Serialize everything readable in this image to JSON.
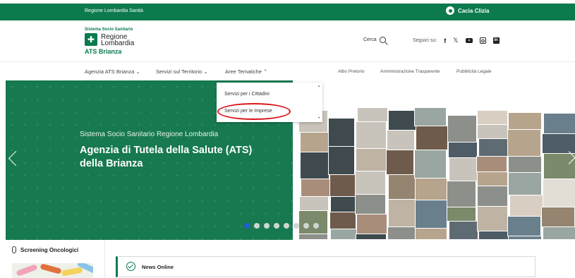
{
  "topbar": {
    "brand": "Regione Lombardia Sanità",
    "user": "Cacia Clizia"
  },
  "header": {
    "logo_top": "Sistema Socio Sanitario",
    "logo_region_line1": "Regione",
    "logo_region_line2": "Lombardia",
    "logo_ats": "ATS Brianza",
    "search_label": "Cerca",
    "social_label": "Seguici su:",
    "social_icons": [
      "facebook-icon",
      "x-icon",
      "youtube-icon",
      "instagram-icon",
      "linkedin-icon"
    ]
  },
  "nav": {
    "items": [
      "Agenzia ATS Brianza ⌄",
      "Servizi sul Territorio ⌄",
      "Aree Tematiche ⌃"
    ],
    "secondary": [
      "Albo Pretorio",
      "Amministrazione Trasparente",
      "Pubblicità Legale"
    ]
  },
  "dropdown": {
    "items": [
      "Servizi per i Cittadini",
      "Servizi per le Imprese"
    ],
    "highlighted": "Servizi per le Imprese"
  },
  "hero": {
    "kicker": "Sistema Socio Sanitario Regione Lombardia",
    "title": "Agenzia di Tutela della Salute (ATS) della Brianza",
    "slide_count": 8,
    "active_slide": 1
  },
  "bottom": {
    "sidebar_title": "Screening Oncologici",
    "news_label": "News Online"
  },
  "colors": {
    "brand_green": "#0b7a4d",
    "hero_green": "#17794f",
    "highlight_red": "#d8161b",
    "active_dot": "#1f5fd1"
  }
}
